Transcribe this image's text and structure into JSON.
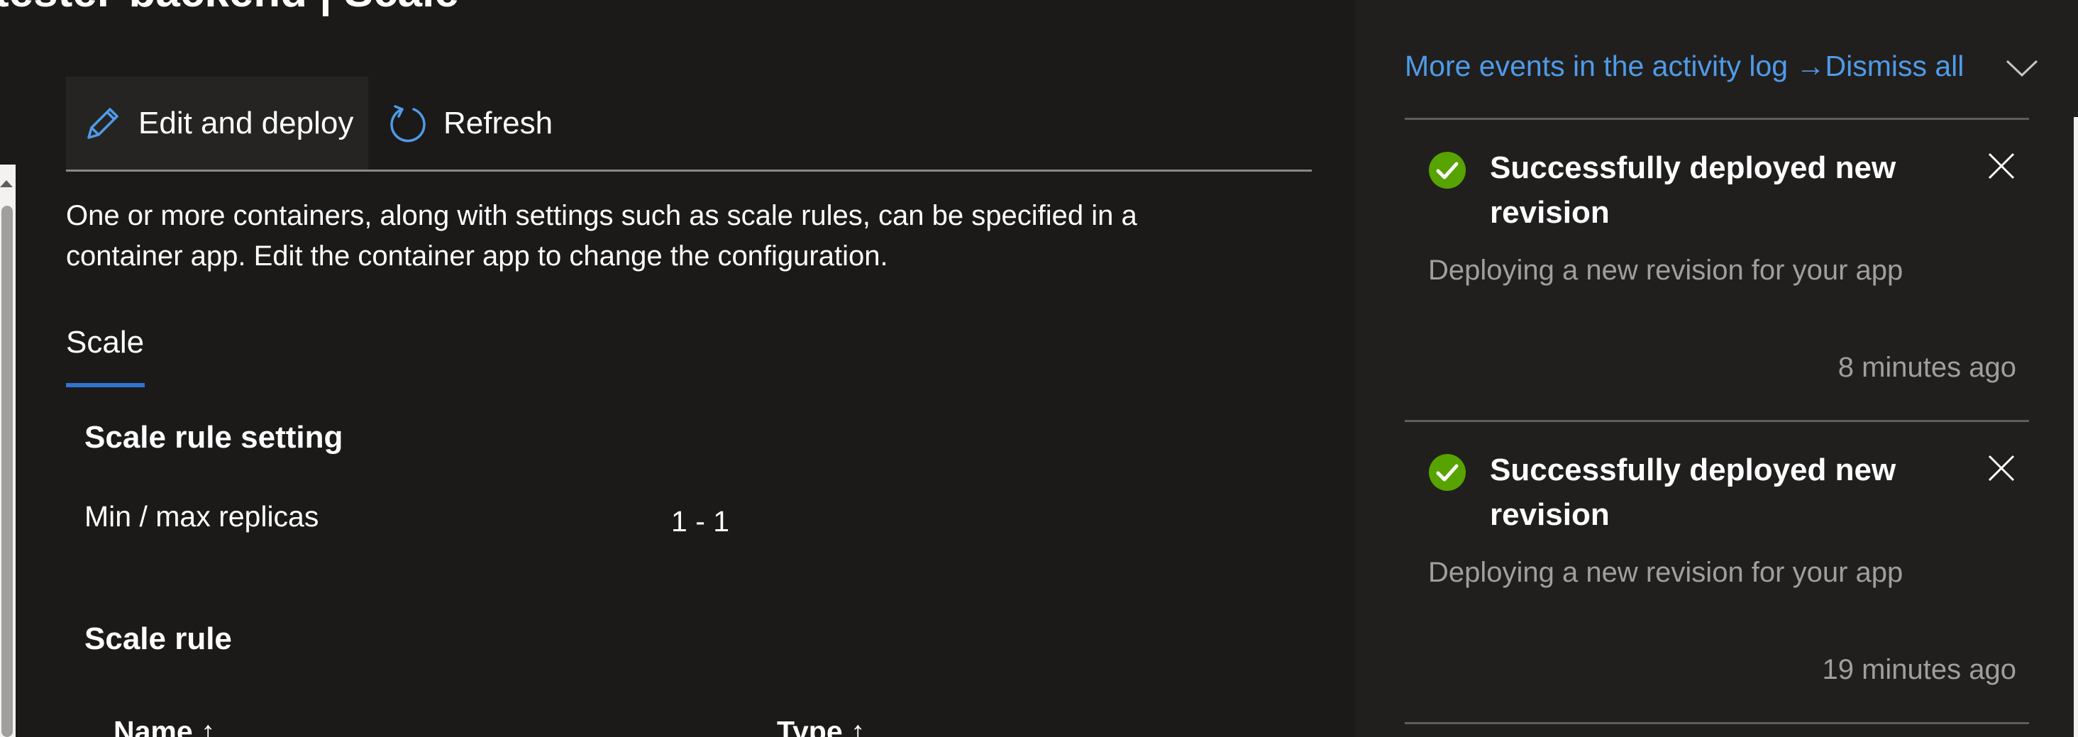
{
  "page": {
    "title": "tester-backend | Scale"
  },
  "toolbar": {
    "edit_label": "Edit and deploy",
    "refresh_label": "Refresh"
  },
  "main": {
    "description_line1": "One or more containers, along with settings such as scale rules, can be specified in a",
    "description_line2": "container app. Edit the container app to change the configuration.",
    "tab_label": "Scale",
    "scale_rule_setting_title": "Scale rule setting",
    "replicas_label": "Min / max replicas",
    "replicas_value": "1 - 1",
    "scale_rule_title": "Scale rule",
    "columns": [
      "Name ↑",
      "Type ↑"
    ]
  },
  "notifications": {
    "activity_log_link": "More events in the activity log →",
    "dismiss_all": "Dismiss all",
    "items": [
      {
        "title": "Successfully deployed new revision",
        "description": "Deploying a new revision for your app",
        "time": "8 minutes ago"
      },
      {
        "title": "Successfully deployed new revision",
        "description": "Deploying a new revision for your app",
        "time": "19 minutes ago"
      }
    ]
  },
  "colors": {
    "background": "#1b1a19",
    "panel": "#201f1e",
    "accent_link": "#4f9be8",
    "success": "#57a300",
    "tab_underline": "#2f74d0",
    "muted_text": "#a19f9d"
  },
  "icons": {
    "edit": "pencil-icon",
    "refresh": "refresh-icon",
    "success": "check-circle-icon",
    "close": "close-icon",
    "collapse": "chevron-down-icon"
  }
}
